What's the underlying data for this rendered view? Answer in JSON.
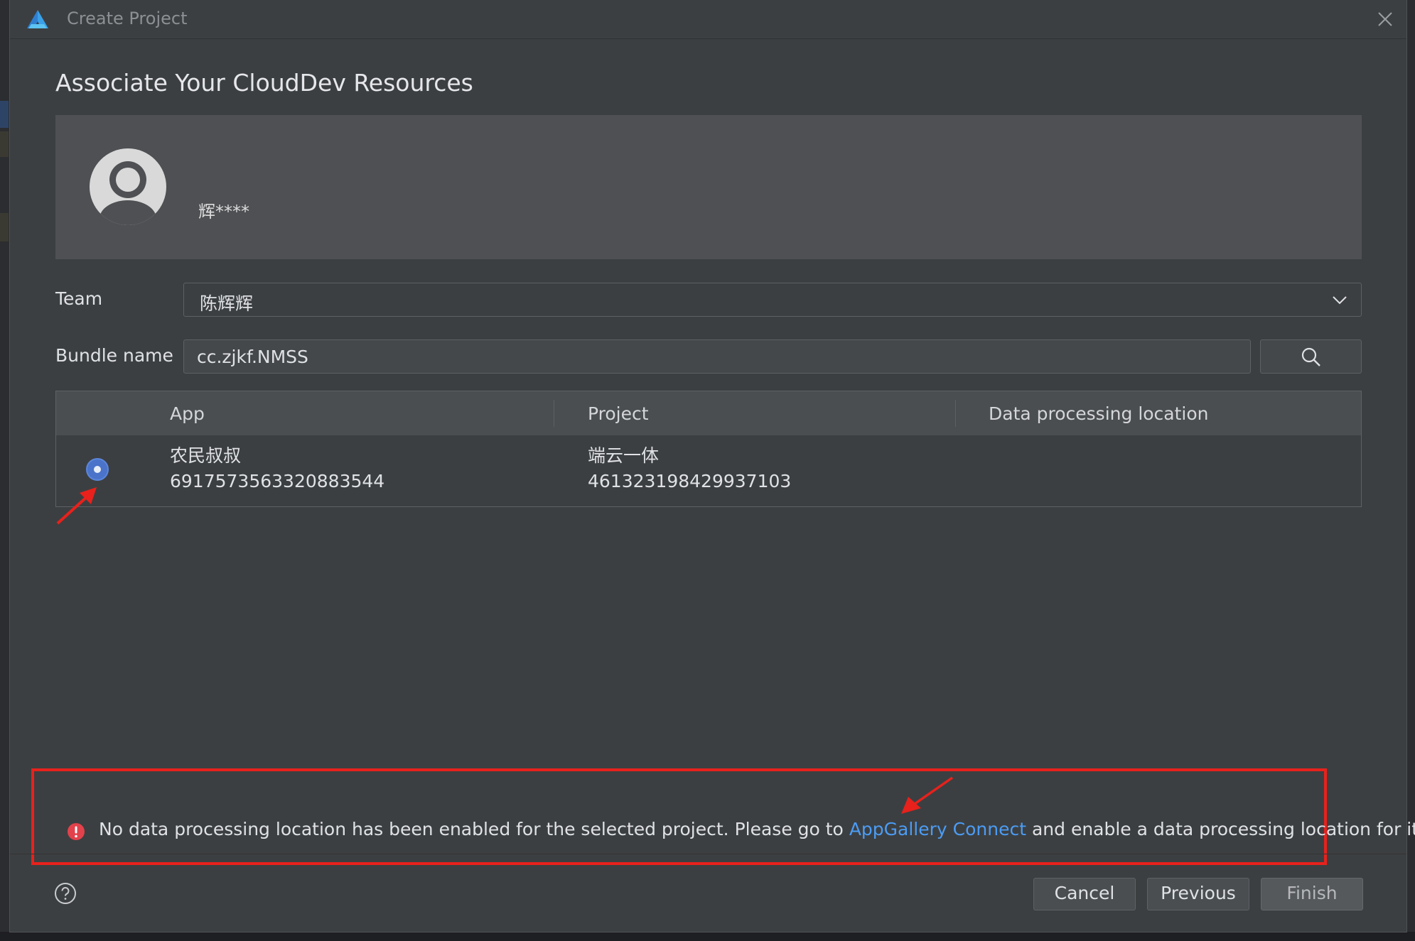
{
  "dialog": {
    "title": "Create Project",
    "heading": "Associate Your CloudDev Resources"
  },
  "account": {
    "name": "辉****"
  },
  "team": {
    "label": "Team",
    "value": "陈辉辉"
  },
  "bundle": {
    "label": "Bundle name",
    "value": "cc.zjkf.NMSS"
  },
  "table": {
    "columns": [
      "App",
      "Project",
      "Data processing location"
    ],
    "rows": [
      {
        "app_name": "农民叔叔",
        "app_id": "6917573563320883544",
        "project_name": "端云一体",
        "project_id": "461323198429937103",
        "location": ""
      }
    ]
  },
  "notice": {
    "text_before": "No data processing location has been enabled for the selected project. Please go to ",
    "link_text": "AppGallery Connect",
    "text_after": " and enable a data processing location for it."
  },
  "buttons": {
    "cancel": "Cancel",
    "previous": "Previous",
    "finish": "Finish"
  },
  "colors": {
    "accent": "#4b9cf5",
    "radio": "#4a73c9",
    "error": "#e2424c",
    "annotation": "#e8211c"
  }
}
